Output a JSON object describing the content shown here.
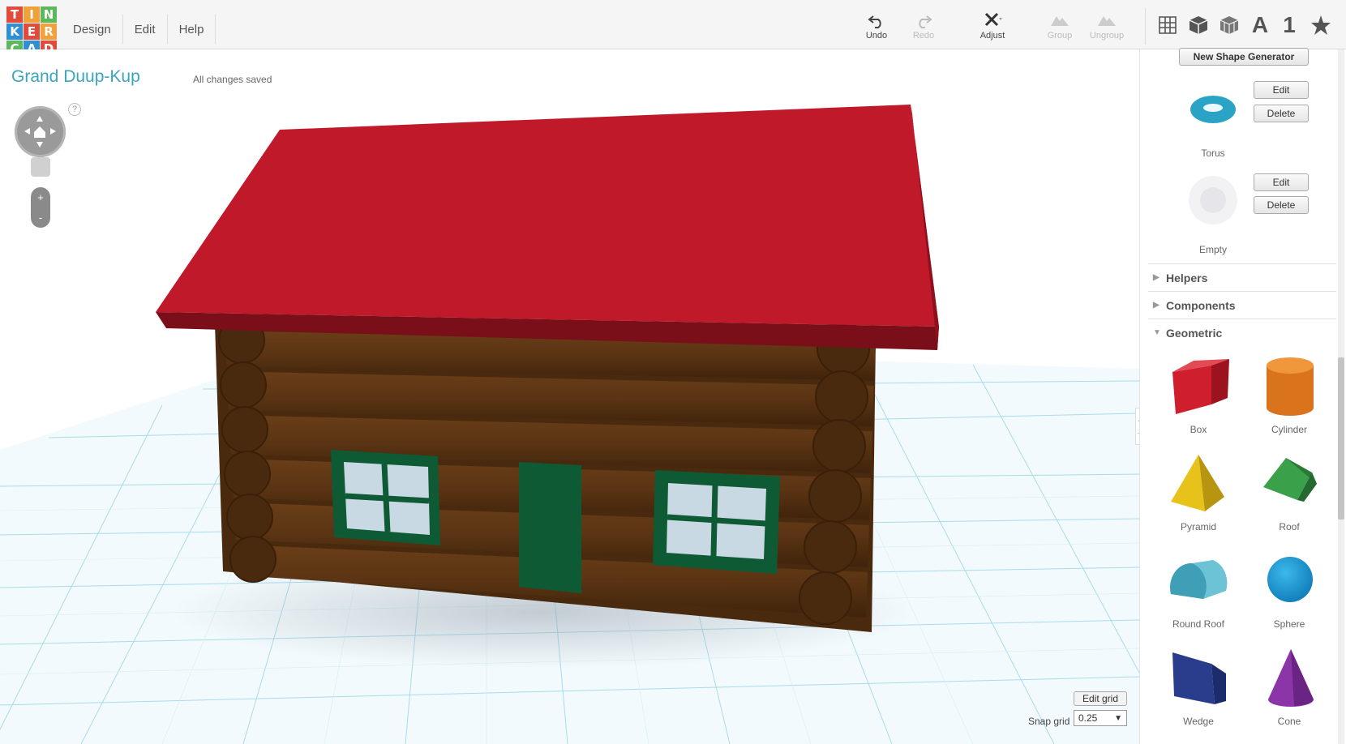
{
  "app": {
    "logo_letters": [
      "T",
      "I",
      "N",
      "K",
      "E",
      "R",
      "C",
      "A",
      "D"
    ]
  },
  "menu": {
    "items": [
      "Design",
      "Edit",
      "Help"
    ]
  },
  "toolbar": {
    "undo": "Undo",
    "redo": "Redo",
    "adjust": "Adjust",
    "group": "Group",
    "ungroup": "Ungroup",
    "view_text_icon": "A",
    "view_number_icon": "1"
  },
  "design": {
    "title": "Grand Duup-Kup",
    "save_status": "All changes saved"
  },
  "navigation": {
    "help": "?",
    "zoom_in": "+",
    "zoom_out": "-"
  },
  "grid": {
    "edit_grid": "Edit grid",
    "snap_label": "Snap grid",
    "snap_value": "0.25"
  },
  "panel": {
    "new_shape_generator": "New Shape Generator",
    "custom_shapes": [
      {
        "name": "Torus",
        "edit": "Edit",
        "delete": "Delete"
      },
      {
        "name": "Empty",
        "edit": "Edit",
        "delete": "Delete"
      }
    ],
    "categories": [
      {
        "name": "Helpers",
        "expanded": false
      },
      {
        "name": "Components",
        "expanded": false
      },
      {
        "name": "Geometric",
        "expanded": true
      }
    ],
    "geometric_shapes": [
      "Box",
      "Cylinder",
      "Pyramid",
      "Roof",
      "Round Roof",
      "Sphere",
      "Wedge",
      "Cone"
    ]
  },
  "colors": {
    "roof": "#c0192a",
    "logs": "#5a3413",
    "trim": "#0e5a34",
    "grid": "#8fd0e6",
    "title": "#3aa6bd"
  }
}
